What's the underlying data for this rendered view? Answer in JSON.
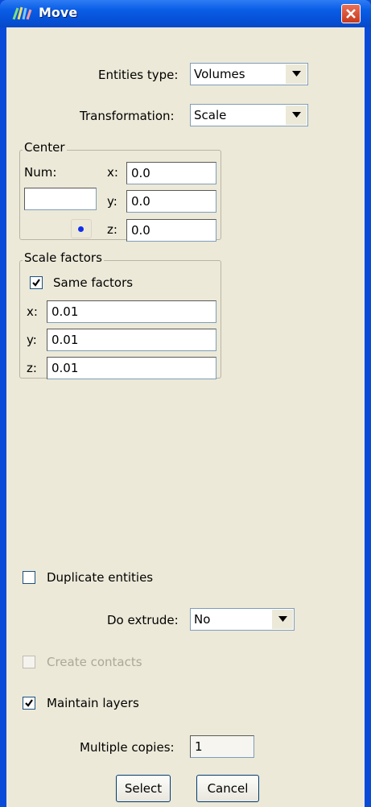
{
  "window": {
    "title": "Move",
    "title_icon": "app-icon",
    "close_icon": "close-icon"
  },
  "entities_type": {
    "label": "Entities type:",
    "value": "Volumes"
  },
  "transformation": {
    "label": "Transformation:",
    "value": "Scale"
  },
  "center": {
    "title": "Center",
    "num_label": "Num:",
    "num_value": "",
    "x_label": "x:",
    "x_value": "0.0",
    "y_label": "y:",
    "y_value": "0.0",
    "z_label": "z:",
    "z_value": "0.0"
  },
  "scale_factors": {
    "title": "Scale factors",
    "same_factors_label": "Same factors",
    "same_factors_checked": true,
    "x_label": "x:",
    "x_value": "0.01",
    "y_label": "y:",
    "y_value": "0.01",
    "z_label": "z:",
    "z_value": "0.01"
  },
  "duplicate_entities": {
    "label": "Duplicate entities",
    "checked": false
  },
  "do_extrude": {
    "label": "Do extrude:",
    "value": "No"
  },
  "create_contacts": {
    "label": "Create contacts",
    "checked": false,
    "enabled": false
  },
  "maintain_layers": {
    "label": "Maintain layers",
    "checked": true
  },
  "multiple_copies": {
    "label": "Multiple copies:",
    "value": "1"
  },
  "buttons": {
    "select": "Select",
    "cancel": "Cancel"
  }
}
